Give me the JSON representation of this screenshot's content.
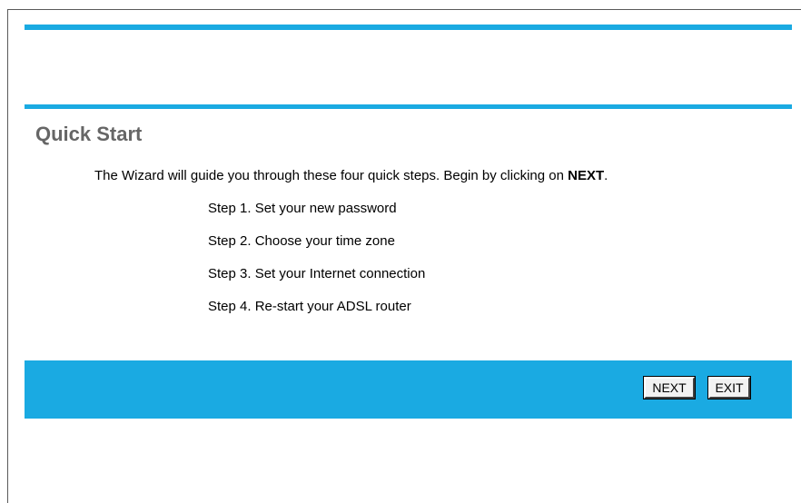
{
  "page": {
    "title": "Quick Start"
  },
  "intro": {
    "text_before": "The Wizard will guide you through these four quick steps. Begin by clicking on ",
    "emphasis": "NEXT",
    "text_after": "."
  },
  "steps": [
    "Step 1. Set your new password",
    "Step 2. Choose your time zone",
    "Step 3. Set your Internet connection",
    "Step 4. Re-start your ADSL router"
  ],
  "actions": {
    "next_label": "NEXT",
    "exit_label": "EXIT"
  },
  "colors": {
    "accent": "#1aaae2",
    "title": "#666666",
    "background": "#ffffff"
  }
}
